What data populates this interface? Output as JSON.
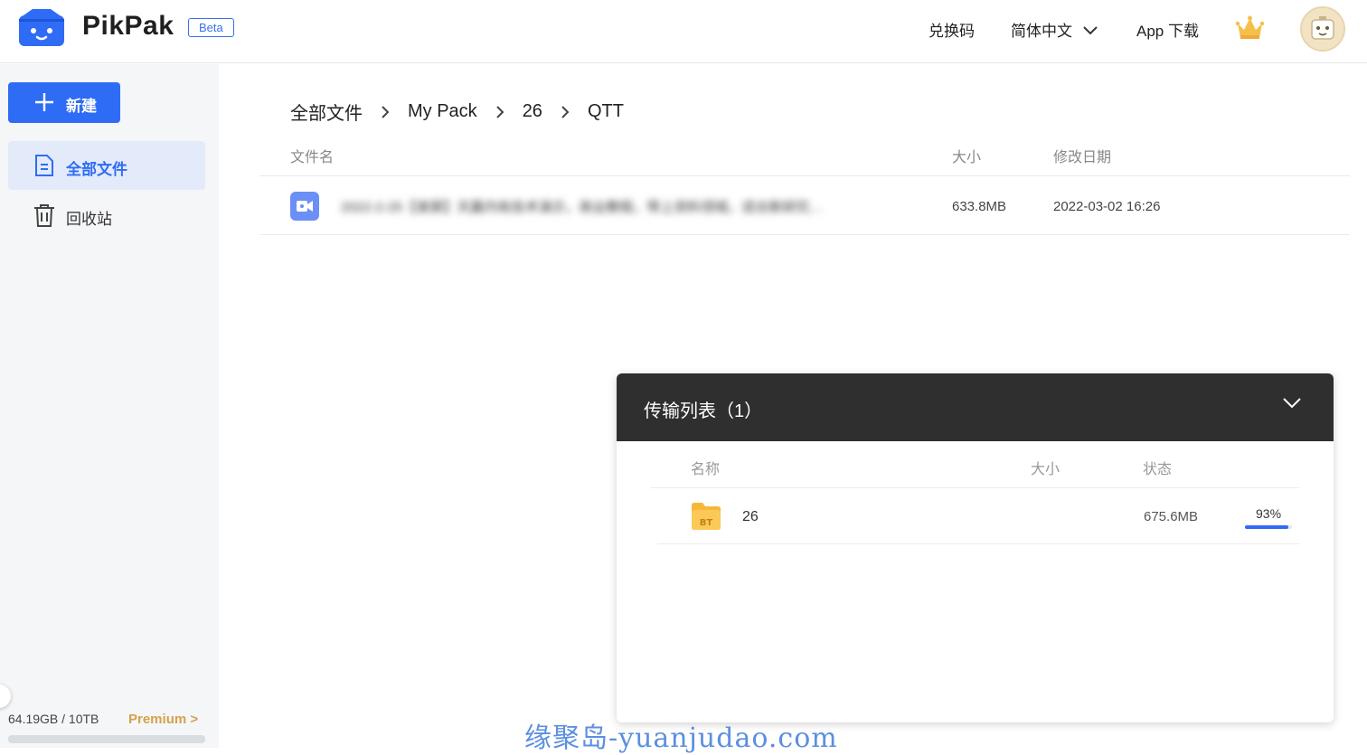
{
  "header": {
    "logo_text": "PikPak",
    "beta_label": "Beta",
    "redeem_label": "兑换码",
    "language_label": "简体中文",
    "app_download_label": "App 下载"
  },
  "sidebar": {
    "new_button_label": "新建",
    "items": [
      {
        "label": "全部文件",
        "active": true,
        "icon": "document-icon"
      },
      {
        "label": "回收站",
        "active": false,
        "icon": "trash-icon"
      }
    ],
    "storage_text": "64.19GB / 10TB",
    "premium_label": "Premium >",
    "storage_used_fraction": 0.0064
  },
  "breadcrumb": [
    "全部文件",
    "My Pack",
    "26",
    "QTT"
  ],
  "file_table": {
    "columns": {
      "name": "文件名",
      "size": "大小",
      "date": "修改日期"
    },
    "rows": [
      {
        "name": "2022-2-25【录屏】天赢内有技术演示，商业教程，带上资料领域，适合新研究…",
        "size": "633.8MB",
        "date": "2022-03-02 16:26",
        "icon": "video-icon"
      }
    ]
  },
  "transfer_panel": {
    "title": "传输列表（1）",
    "columns": {
      "name": "名称",
      "size": "大小",
      "status": "状态"
    },
    "rows": [
      {
        "name": "26",
        "size": "675.6MB",
        "progress_label": "93%",
        "progress": 0.93,
        "icon": "bt-folder-icon"
      }
    ]
  },
  "watermark": "缘聚岛-yuanjudao.com",
  "colors": {
    "accent": "#2f6cf5",
    "premium": "#d4a24c",
    "panel_header": "#2f2f2f"
  }
}
